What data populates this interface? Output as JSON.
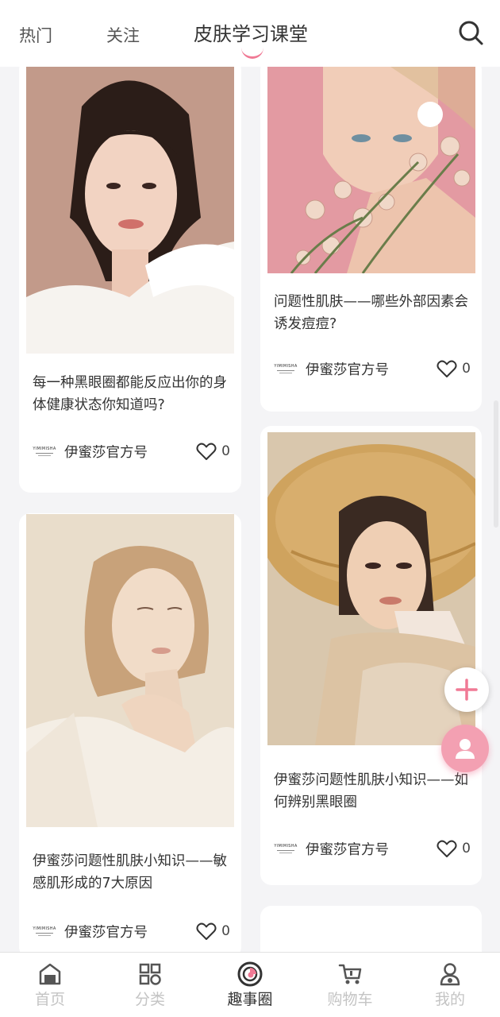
{
  "tabs": [
    {
      "label": "热门"
    },
    {
      "label": "关注"
    },
    {
      "label": "皮肤学习课堂"
    }
  ],
  "active_tab_index": 2,
  "search": {
    "icon": "search-icon"
  },
  "cards": [
    {
      "title": "每一种黑眼圈都能反应出你的身体健康状态你知道吗?",
      "author": "伊蜜莎官方号",
      "logo_text": "YIMIMISHA",
      "likes": "0"
    },
    {
      "title": "问题性肌肤——哪些外部因素会诱发痘痘?",
      "author": "伊蜜莎官方号",
      "logo_text": "YIMIMISHA",
      "likes": "0"
    },
    {
      "title": "伊蜜莎问题性肌肤小知识——敏感肌形成的7大原因",
      "author": "伊蜜莎官方号",
      "logo_text": "YIMIMISHA",
      "likes": "0"
    },
    {
      "title": "伊蜜莎问题性肌肤小知识——如何辨别黑眼圈",
      "author": "伊蜜莎官方号",
      "logo_text": "YIMIMISHA",
      "likes": "0"
    }
  ],
  "fab": {
    "add_icon": "plus-icon",
    "user_icon": "user-icon"
  },
  "bottom_nav": [
    {
      "label": "首页",
      "icon": "home-icon"
    },
    {
      "label": "分类",
      "icon": "grid-icon"
    },
    {
      "label": "趣事圈",
      "icon": "circle-icon"
    },
    {
      "label": "购物车",
      "icon": "cart-icon"
    },
    {
      "label": "我的",
      "icon": "profile-icon"
    }
  ],
  "active_nav_index": 2,
  "colors": {
    "accent": "#f07a95",
    "fab_user": "#f3a0b2",
    "background": "#f4f4f6"
  }
}
